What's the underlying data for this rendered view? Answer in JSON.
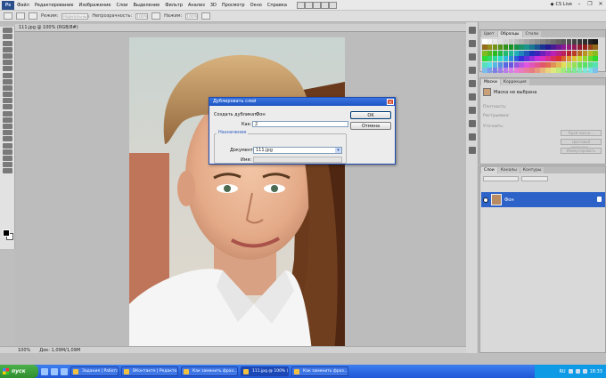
{
  "menu": {
    "logo": "Ps",
    "items": [
      "Файл",
      "Редактирование",
      "Изображение",
      "Слои",
      "Выделение",
      "Фильтр",
      "Анализ",
      "3D",
      "Просмотр",
      "Окно",
      "Справка"
    ],
    "cs_live": "CS Live"
  },
  "options": {
    "mode_label": "Режим:",
    "mode_value": "Нормальный",
    "opacity_label": "Непрозрачность:",
    "opacity_value": "100%",
    "pressure_label": "Нажим:",
    "pressure_value": "100%"
  },
  "document": {
    "tab_title": "111.jpg @ 100% (RGB/8#)",
    "zoom": "100%",
    "doc_info": "Док: 1,09M/1,09M"
  },
  "panels": {
    "swatches_tabs": [
      "Цвет",
      "Образцы",
      "Стили"
    ],
    "masks_tabs": [
      "Маски",
      "Коррекция"
    ],
    "mask_label": "Маска не выбрана",
    "mask_fields": [
      "Плотность:",
      "Растушевка:",
      "Уточнить:"
    ],
    "mask_buttons": [
      "Край маски...",
      "Цветовой диапазон...",
      "Инвертировать"
    ],
    "layers_tabs": [
      "Слои",
      "Каналы",
      "Контуры"
    ],
    "layer_name": "Фон"
  },
  "dialog": {
    "title": "Дублировать слой",
    "duplicate_label": "Создать дубликат:",
    "duplicate_value": "Фон",
    "as_label": "Как:",
    "as_value": "2",
    "destination_group": "Назначение",
    "document_label": "Документ:",
    "document_value": "111.jpg",
    "name_label": "Имя:",
    "ok": "OK",
    "cancel": "Отмена"
  },
  "taskbar": {
    "start": "пуск",
    "tasks": [
      "Задания | Работа@Мэ...",
      "ВКонтакте | Редакто...",
      "Как заменить фраз...",
      "111.jpg @ 100% (RG...",
      "Как заменить фраз..."
    ],
    "lang": "RU",
    "clock": "18:33"
  },
  "colors": {
    "titlebar": "#1e55c4",
    "layer_selected": "#2d62c9",
    "taskbar": "#2057d6"
  }
}
